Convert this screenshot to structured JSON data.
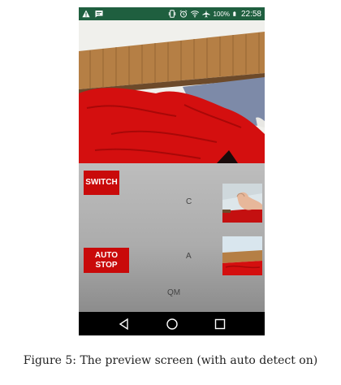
{
  "status_bar": {
    "icons_left": [
      "warning-icon",
      "message-icon"
    ],
    "icons_right": [
      "vibrate-icon",
      "alarm-icon",
      "wifi-icon",
      "airplane-icon",
      "battery-icon"
    ],
    "battery": "100%",
    "time": "22:58"
  },
  "controls": {
    "switch_label": "SWITCH",
    "auto_stop_line1": "AUTO",
    "auto_stop_line2": "STOP",
    "labels": {
      "c": "C",
      "a": "A",
      "qm": "QM"
    }
  },
  "nav": {
    "icons": [
      "back-icon",
      "home-icon",
      "recent-apps-icon"
    ]
  },
  "caption": "Figure 5: The preview screen (with auto detect on)",
  "colors": {
    "status_bar": "#1f5f3f",
    "button": "#c90a0a",
    "fabric": "#d40f0f",
    "wood": "#b57f45"
  }
}
